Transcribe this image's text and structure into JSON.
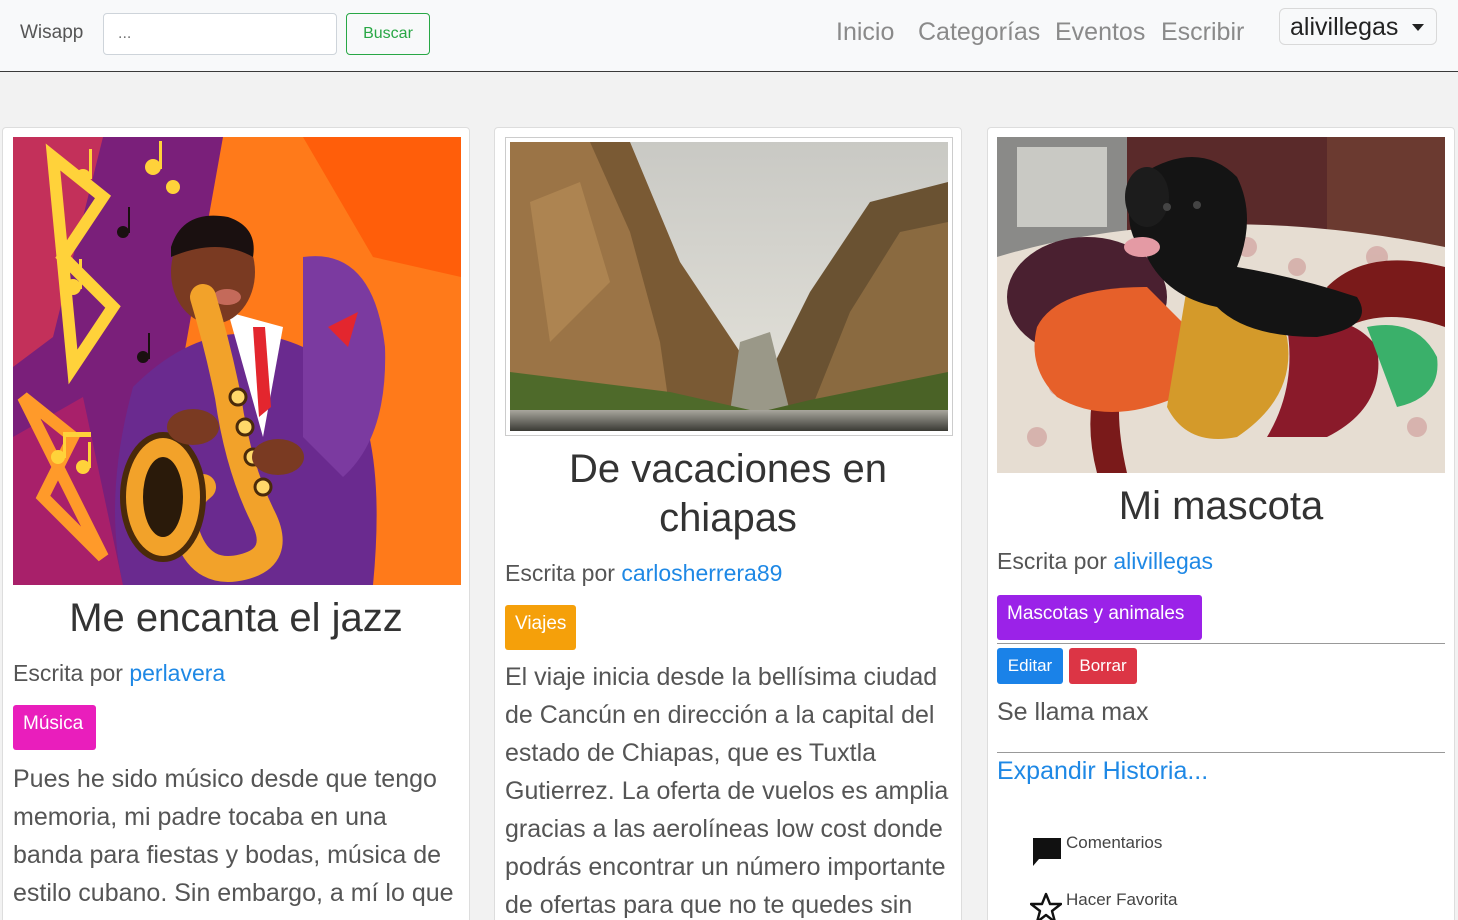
{
  "navbar": {
    "brand": "Wisapp",
    "search_placeholder": "...",
    "search_button": "Buscar",
    "links": [
      "Inicio",
      "Categorías",
      "Eventos",
      "Escribir"
    ],
    "user": "alivillegas"
  },
  "posts": [
    {
      "title": "Me encanta el jazz",
      "author_prefix": "Escrita por",
      "author": "perlavera",
      "category": "Música",
      "category_color": "#e91ebc",
      "excerpt": "Pues he sido músico desde que tengo memoria, mi padre tocaba en una banda para fiestas y bodas, música de estilo cubano. Sin embargo, a mí lo que"
    },
    {
      "title": "De vacaciones en chiapas",
      "author_prefix": "Escrita por",
      "author": "carlosherrera89",
      "category": "Viajes",
      "category_color": "#f5a00a",
      "excerpt": "El viaje inicia desde la bellísima ciudad de Cancún en dirección a la capital del estado de Chiapas, que es Tuxtla Gutierrez. La oferta de vuelos es amplia gracias a las aerolíneas low cost donde podrás encontrar un número importante de ofertas para que no te quedes sin"
    },
    {
      "title": "Mi mascota",
      "author_prefix": "Escrita por",
      "author": "alivillegas",
      "category": "Mascotas y animales",
      "category_color": "#9b22e8",
      "edit_button": "Editar",
      "delete_button": "Borrar",
      "excerpt": "Se llama max",
      "expand_link": "Expandir Historia...",
      "comments_label": "Comentarios",
      "favorite_label": "Hacer Favorita"
    }
  ],
  "colors": {
    "link": "#1e88e5",
    "edit": "#1a82e8",
    "delete": "#dc3545",
    "search_button": "#28a745"
  }
}
